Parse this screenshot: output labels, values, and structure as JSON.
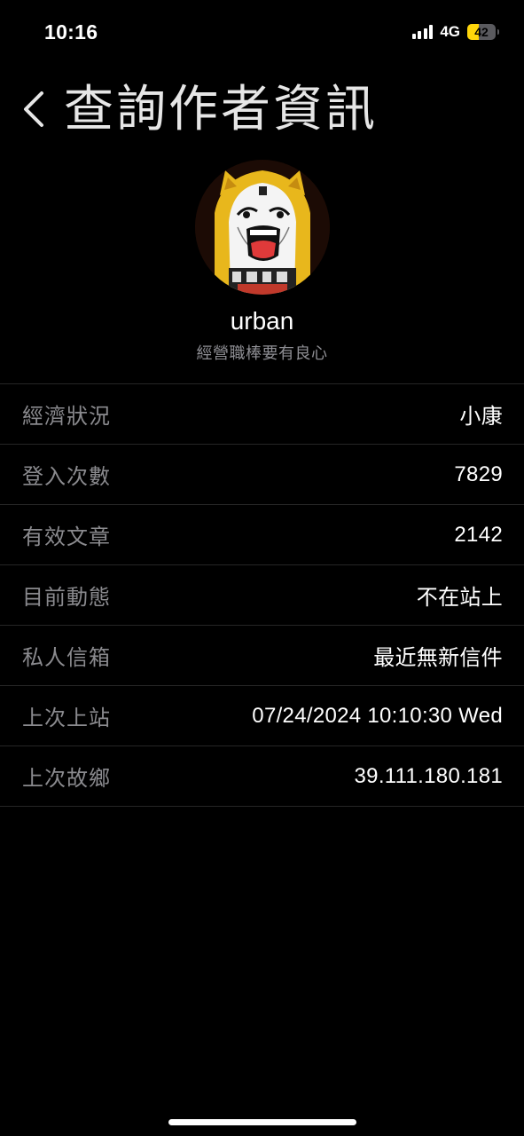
{
  "status_bar": {
    "time": "10:16",
    "network": "4G",
    "battery_percent": "42",
    "battery_level": 0.42,
    "signal_bars": 4
  },
  "header": {
    "title": "查詢作者資訊",
    "back_icon": "chevron-left-icon"
  },
  "profile": {
    "username": "urban",
    "nickname": "經營職棒要有良心"
  },
  "info": [
    {
      "label": "經濟狀況",
      "value": "小康"
    },
    {
      "label": "登入次數",
      "value": "7829"
    },
    {
      "label": "有效文章",
      "value": "2142"
    },
    {
      "label": "目前動態",
      "value": "不在站上"
    },
    {
      "label": "私人信箱",
      "value": "最近無新信件"
    },
    {
      "label": "上次上站",
      "value": "07/24/2024 10:10:30 Wed"
    },
    {
      "label": "上次故鄉",
      "value": "39.111.180.181"
    }
  ],
  "colors": {
    "background": "#000000",
    "label": "#8a8a8e",
    "value": "#ffffff",
    "divider": "#262626",
    "battery": "#ffd60a"
  }
}
